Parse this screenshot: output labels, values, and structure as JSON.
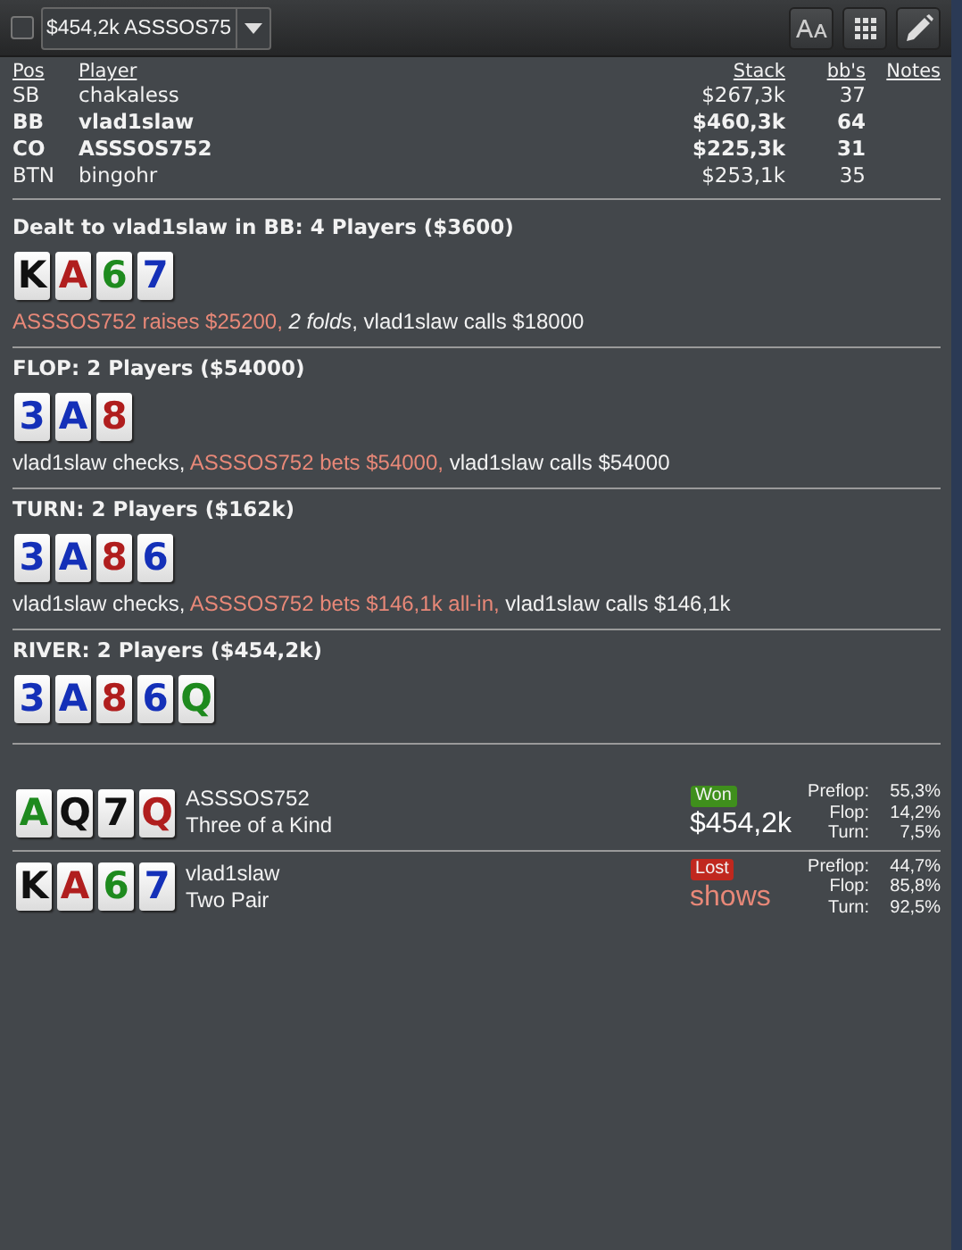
{
  "toolbar": {
    "checkbox": {
      "checked": false
    },
    "hand_select": {
      "value": "$454,2k ASSSOS75"
    },
    "buttons": [
      {
        "kind": "font"
      },
      {
        "kind": "grid"
      },
      {
        "kind": "edit"
      }
    ]
  },
  "players_table": {
    "columns": [
      "Pos",
      "Player",
      "Stack",
      "bb's",
      "Notes"
    ],
    "rows": [
      {
        "pos": "SB",
        "player": "chakaless",
        "stack": "$267,3k",
        "bbs": "37",
        "in_hand": false
      },
      {
        "pos": "BB",
        "player": "vlad1slaw",
        "stack": "$460,3k",
        "bbs": "64",
        "in_hand": true
      },
      {
        "pos": "CO",
        "player": "ASSSOS752",
        "stack": "$225,3k",
        "bbs": "31",
        "in_hand": true
      },
      {
        "pos": "BTN",
        "player": "bingohr",
        "stack": "$253,1k",
        "bbs": "35",
        "in_hand": false
      }
    ]
  },
  "streets": [
    {
      "heading": "Dealt to vlad1slaw in BB: 4 Players ($3600)",
      "cards": [
        {
          "rank": "K",
          "color": "#111111"
        },
        {
          "rank": "A",
          "color": "#b01e1e"
        },
        {
          "rank": "6",
          "color": "#1e8a1e"
        },
        {
          "rank": "7",
          "color": "#1430b8"
        }
      ],
      "actions": [
        {
          "text": "ASSSOS752 raises $25200, ",
          "kind": "villain"
        },
        {
          "text": "2 folds",
          "kind": "folds"
        },
        {
          "text": ", vlad1slaw calls $18000",
          "kind": "plain"
        }
      ]
    },
    {
      "heading": "FLOP: 2 Players ($54000)",
      "cards": [
        {
          "rank": "3",
          "color": "#1430b8"
        },
        {
          "rank": "A",
          "color": "#1430b8"
        },
        {
          "rank": "8",
          "color": "#b01e1e"
        }
      ],
      "actions": [
        {
          "text": "vlad1slaw checks, ",
          "kind": "plain"
        },
        {
          "text": "ASSSOS752 bets $54000, ",
          "kind": "villain"
        },
        {
          "text": "vlad1slaw calls $54000",
          "kind": "plain"
        }
      ]
    },
    {
      "heading": "TURN: 2 Players ($162k)",
      "cards": [
        {
          "rank": "3",
          "color": "#1430b8"
        },
        {
          "rank": "A",
          "color": "#1430b8"
        },
        {
          "rank": "8",
          "color": "#b01e1e"
        },
        {
          "rank": "6",
          "color": "#1430b8"
        }
      ],
      "actions": [
        {
          "text": "vlad1slaw checks, ",
          "kind": "plain"
        },
        {
          "text": "ASSSOS752 bets $146,1k all-in, ",
          "kind": "villain"
        },
        {
          "text": "vlad1slaw calls $146,1k",
          "kind": "plain"
        }
      ]
    },
    {
      "heading": "RIVER: 2 Players ($454,2k)",
      "cards": [
        {
          "rank": "3",
          "color": "#1430b8"
        },
        {
          "rank": "A",
          "color": "#1430b8"
        },
        {
          "rank": "8",
          "color": "#b01e1e"
        },
        {
          "rank": "6",
          "color": "#1430b8"
        },
        {
          "rank": "Q",
          "color": "#1e8a1e"
        }
      ]
    }
  ],
  "showdown": [
    {
      "cards": [
        {
          "rank": "A",
          "color": "#1e8a1e"
        },
        {
          "rank": "Q",
          "color": "#111111"
        },
        {
          "rank": "7",
          "color": "#111111"
        },
        {
          "rank": "Q",
          "color": "#b01e1e"
        }
      ],
      "player": "ASSSOS752",
      "hand": "Three of a Kind",
      "result": {
        "kind": "won",
        "label": "Won"
      },
      "outcome": {
        "kind": "amount",
        "text": "$454,2k"
      },
      "equity": [
        {
          "label": "Preflop:",
          "value": "55,3%"
        },
        {
          "label": "Flop:",
          "value": "14,2%"
        },
        {
          "label": "Turn:",
          "value": "7,5%"
        }
      ]
    },
    {
      "cards": [
        {
          "rank": "K",
          "color": "#111111"
        },
        {
          "rank": "A",
          "color": "#b01e1e"
        },
        {
          "rank": "6",
          "color": "#1e8a1e"
        },
        {
          "rank": "7",
          "color": "#1430b8"
        }
      ],
      "player": "vlad1slaw",
      "hand": "Two Pair",
      "result": {
        "kind": "lost",
        "label": "Lost"
      },
      "outcome": {
        "kind": "shows",
        "text": "shows"
      },
      "equity": [
        {
          "label": "Preflop:",
          "value": "44,7%"
        },
        {
          "label": "Flop:",
          "value": "85,8%"
        },
        {
          "label": "Turn:",
          "value": "92,5%"
        }
      ]
    }
  ]
}
